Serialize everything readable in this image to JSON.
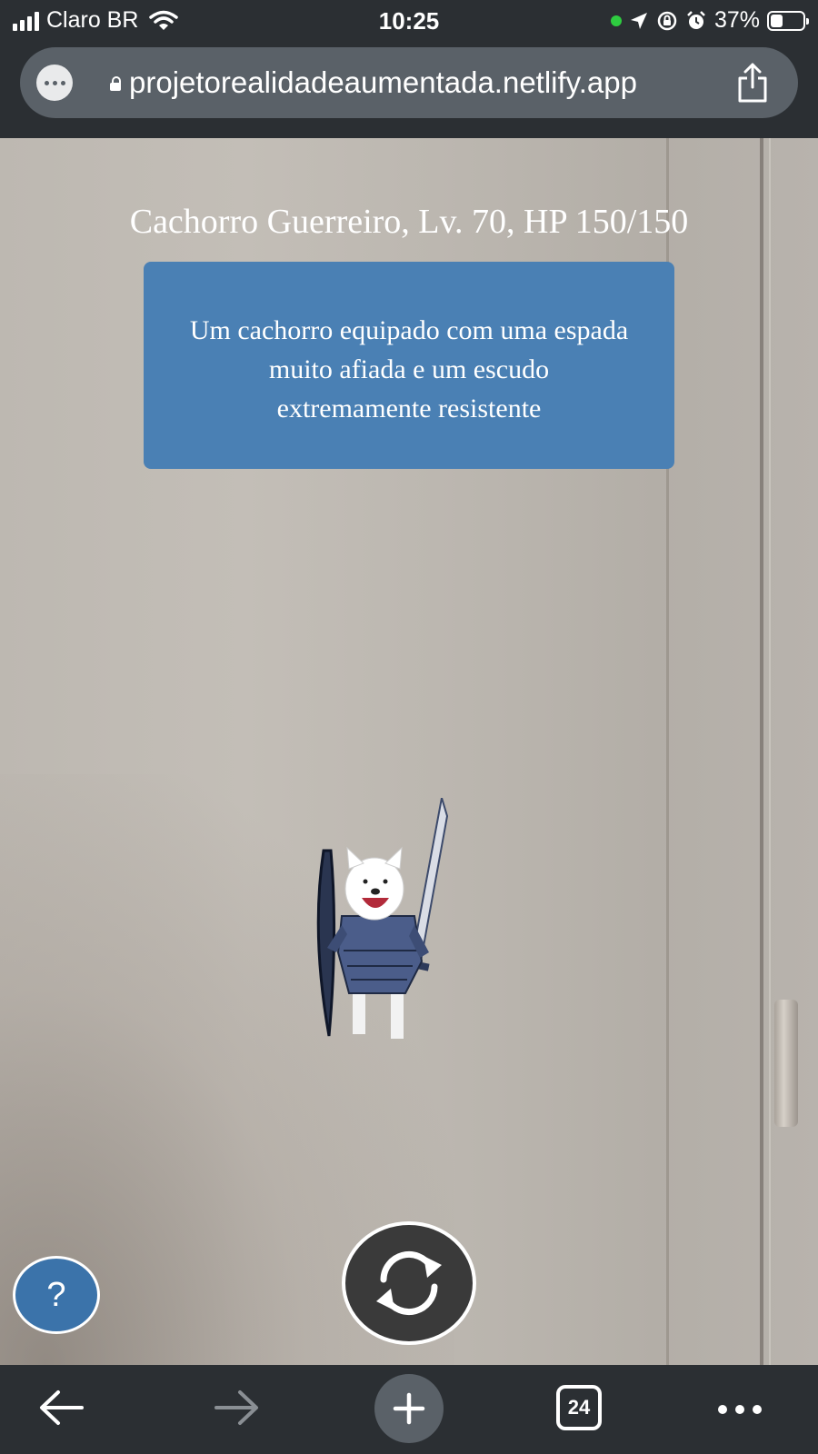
{
  "status_bar": {
    "carrier": "Claro BR",
    "time": "10:25",
    "battery_percent": "37%",
    "battery_level": 0.37
  },
  "browser": {
    "url": "projetorealidadeaumentada.netlify.app"
  },
  "ar_scene": {
    "title": "Cachorro Guerreiro, Lv. 70, HP 150/150",
    "description": "Um cachorro equipado com uma espada muito afiada e um escudo extremamente resistente"
  },
  "controls": {
    "help_label": "?"
  },
  "toolbar": {
    "tab_count": "24"
  },
  "colors": {
    "description_box": "#4a80b4",
    "help_button": "#3b73aa",
    "chrome": "#2b2f33"
  },
  "icons": [
    "signal-icon",
    "wifi-icon",
    "location-icon",
    "rotation-lock-icon",
    "alarm-icon",
    "battery-icon",
    "more-icon",
    "lock-icon",
    "share-icon",
    "switch-camera-icon",
    "back-arrow-icon",
    "forward-arrow-icon",
    "plus-icon",
    "tabs-icon",
    "ellipsis-icon"
  ]
}
